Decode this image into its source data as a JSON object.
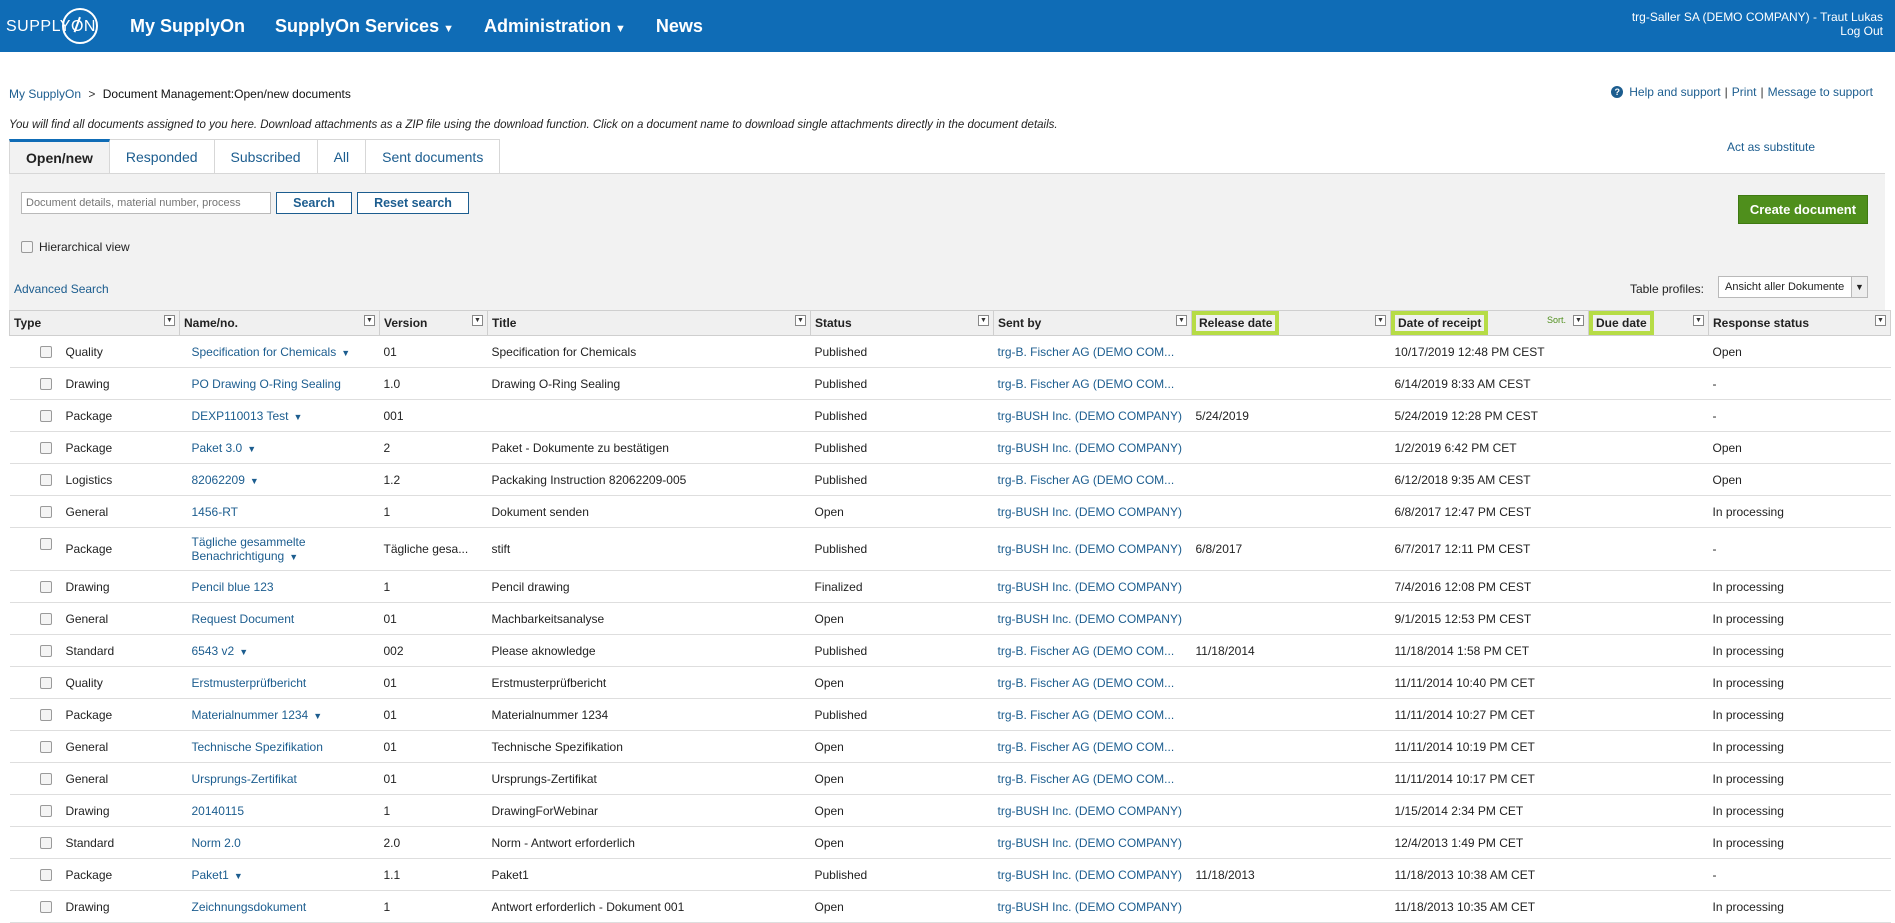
{
  "header": {
    "logo_text": "SUPPLYON",
    "nav": [
      {
        "label": "My SupplyOn",
        "has_menu": false
      },
      {
        "label": "SupplyOn Services",
        "has_menu": true
      },
      {
        "label": "Administration",
        "has_menu": true
      },
      {
        "label": "News",
        "has_menu": false
      }
    ],
    "user": "trg-Saller SA (DEMO COMPANY) - Traut Lukas",
    "logout": "Log Out"
  },
  "breadcrumb": {
    "home": "My SupplyOn",
    "separator": ">",
    "current": "Document Management:Open/new documents"
  },
  "help": {
    "help_support": "Help and support",
    "print": "Print",
    "message": "Message to support",
    "pipe": "|"
  },
  "intro": "You will find all documents assigned to you here. Download attachments as a ZIP file using the download function. Click on a document name to download single attachments directly in the document details.",
  "tabs": [
    {
      "label": "Open/new",
      "active": true
    },
    {
      "label": "Responded",
      "active": false
    },
    {
      "label": "Subscribed",
      "active": false
    },
    {
      "label": "All",
      "active": false
    },
    {
      "label": "Sent documents",
      "active": false
    }
  ],
  "act_as_substitute": "Act as substitute",
  "filter": {
    "search_placeholder": "Document details, material number, process",
    "search_button": "Search",
    "reset_button": "Reset search",
    "create_button": "Create document",
    "hierarchical_view": "Hierarchical view",
    "advanced_search": "Advanced Search",
    "table_profiles_label": "Table profiles:",
    "table_profile_value": "Ansicht aller Dokumente"
  },
  "table": {
    "columns": [
      "Type",
      "Name/no.",
      "Version",
      "Title",
      "Status",
      "Sent by",
      "Release date",
      "Date of receipt",
      "Due date",
      "Response status"
    ],
    "sort_label": "Sort.",
    "highlight_color": "#b6dc46",
    "rows": [
      {
        "type": "Quality",
        "name": "Specification for Chemicals",
        "menu": true,
        "version": "01",
        "title": "Specification for Chemicals",
        "status": "Published",
        "sent_by": "trg-B. Fischer AG (DEMO COM...",
        "release": "",
        "receipt": "10/17/2019 12:48 PM CEST",
        "due": "",
        "response": "Open"
      },
      {
        "type": "Drawing",
        "name": "PO Drawing O-Ring Sealing",
        "menu": false,
        "version": "1.0",
        "title": "Drawing O-Ring Sealing",
        "status": "Published",
        "sent_by": "trg-B. Fischer AG (DEMO COM...",
        "release": "",
        "receipt": "6/14/2019 8:33 AM CEST",
        "due": "",
        "response": "-"
      },
      {
        "type": "Package",
        "name": "DEXP110013 Test",
        "menu": true,
        "version": "001",
        "title": "",
        "status": "Published",
        "sent_by": "trg-BUSH Inc. (DEMO COMPANY)",
        "release": "5/24/2019",
        "receipt": "5/24/2019 12:28 PM CEST",
        "due": "",
        "response": "-"
      },
      {
        "type": "Package",
        "name": "Paket 3.0",
        "menu": true,
        "version": "2",
        "title": "Paket - Dokumente zu bestätigen",
        "status": "Published",
        "sent_by": "trg-BUSH Inc. (DEMO COMPANY)",
        "release": "",
        "receipt": "1/2/2019 6:42 PM CET",
        "due": "",
        "response": "Open"
      },
      {
        "type": "Logistics",
        "name": "82062209",
        "menu": true,
        "version": "1.2",
        "title": "Packaking Instruction 82062209-005",
        "status": "Published",
        "sent_by": "trg-B. Fischer AG (DEMO COM...",
        "release": "",
        "receipt": "6/12/2018 9:35 AM CEST",
        "due": "",
        "response": "Open"
      },
      {
        "type": "General",
        "name": "1456-RT",
        "menu": false,
        "version": "1",
        "title": "Dokument senden",
        "status": "Open",
        "sent_by": "trg-BUSH Inc. (DEMO COMPANY)",
        "release": "",
        "receipt": "6/8/2017 12:47 PM CEST",
        "due": "",
        "response": "In processing"
      },
      {
        "type": "Package",
        "name": "Tägliche gesammelte Benachrichtigung",
        "menu": true,
        "version": "Tägliche gesa...",
        "title": "stift",
        "status": "Published",
        "sent_by": "trg-BUSH Inc. (DEMO COMPANY)",
        "release": "6/8/2017",
        "receipt": "6/7/2017 12:11 PM CEST",
        "due": "",
        "response": "-",
        "tall": true
      },
      {
        "type": "Drawing",
        "name": "Pencil blue 123",
        "menu": false,
        "version": "1",
        "title": "Pencil drawing",
        "status": "Finalized",
        "sent_by": "trg-BUSH Inc. (DEMO COMPANY)",
        "release": "",
        "receipt": "7/4/2016 12:08 PM CEST",
        "due": "",
        "response": "In processing"
      },
      {
        "type": "General",
        "name": "Request Document",
        "menu": false,
        "version": "01",
        "title": "Machbarkeitsanalyse",
        "status": "Open",
        "sent_by": "trg-BUSH Inc. (DEMO COMPANY)",
        "release": "",
        "receipt": "9/1/2015 12:53 PM CEST",
        "due": "",
        "response": "In processing"
      },
      {
        "type": "Standard",
        "name": "6543 v2",
        "menu": true,
        "version": "002",
        "title": "Please aknowledge",
        "status": "Published",
        "sent_by": "trg-B. Fischer AG (DEMO COM...",
        "release": "11/18/2014",
        "receipt": "11/18/2014 1:58 PM CET",
        "due": "",
        "response": "In processing"
      },
      {
        "type": "Quality",
        "name": "Erstmusterprüfbericht",
        "menu": false,
        "version": "01",
        "title": "Erstmusterprüfbericht",
        "status": "Open",
        "sent_by": "trg-B. Fischer AG (DEMO COM...",
        "release": "",
        "receipt": "11/11/2014 10:40 PM CET",
        "due": "",
        "response": "In processing"
      },
      {
        "type": "Package",
        "name": "Materialnummer 1234",
        "menu": true,
        "version": "01",
        "title": "Materialnummer 1234",
        "status": "Published",
        "sent_by": "trg-B. Fischer AG (DEMO COM...",
        "release": "",
        "receipt": "11/11/2014 10:27 PM CET",
        "due": "",
        "response": "In processing"
      },
      {
        "type": "General",
        "name": "Technische Spezifikation",
        "menu": false,
        "version": "01",
        "title": "Technische Spezifikation",
        "status": "Open",
        "sent_by": "trg-B. Fischer AG (DEMO COM...",
        "release": "",
        "receipt": "11/11/2014 10:19 PM CET",
        "due": "",
        "response": "In processing"
      },
      {
        "type": "General",
        "name": "Ursprungs-Zertifikat",
        "menu": false,
        "version": "01",
        "title": "Ursprungs-Zertifikat",
        "status": "Open",
        "sent_by": "trg-B. Fischer AG (DEMO COM...",
        "release": "",
        "receipt": "11/11/2014 10:17 PM CET",
        "due": "",
        "response": "In processing"
      },
      {
        "type": "Drawing",
        "name": "20140115",
        "menu": false,
        "version": "1",
        "title": "DrawingForWebinar",
        "status": "Open",
        "sent_by": "trg-BUSH Inc. (DEMO COMPANY)",
        "release": "",
        "receipt": "1/15/2014 2:34 PM CET",
        "due": "",
        "response": "In processing"
      },
      {
        "type": "Standard",
        "name": "Norm 2.0",
        "menu": false,
        "version": "2.0",
        "title": "Norm - Antwort erforderlich",
        "status": "Open",
        "sent_by": "trg-BUSH Inc. (DEMO COMPANY)",
        "release": "",
        "receipt": "12/4/2013 1:49 PM CET",
        "due": "",
        "response": "In processing"
      },
      {
        "type": "Package",
        "name": "Paket1",
        "menu": true,
        "version": "1.1",
        "title": "Paket1",
        "status": "Published",
        "sent_by": "trg-BUSH Inc. (DEMO COMPANY)",
        "release": "11/18/2013",
        "receipt": "11/18/2013 10:38 AM CET",
        "due": "",
        "response": "-"
      },
      {
        "type": "Drawing",
        "name": "Zeichnungsdokument",
        "menu": false,
        "version": "1",
        "title": "Antwort erforderlich - Dokument 001",
        "status": "Open",
        "sent_by": "trg-BUSH Inc. (DEMO COMPANY)",
        "release": "",
        "receipt": "11/18/2013 10:35 AM CET",
        "due": "",
        "response": "In processing"
      }
    ]
  }
}
